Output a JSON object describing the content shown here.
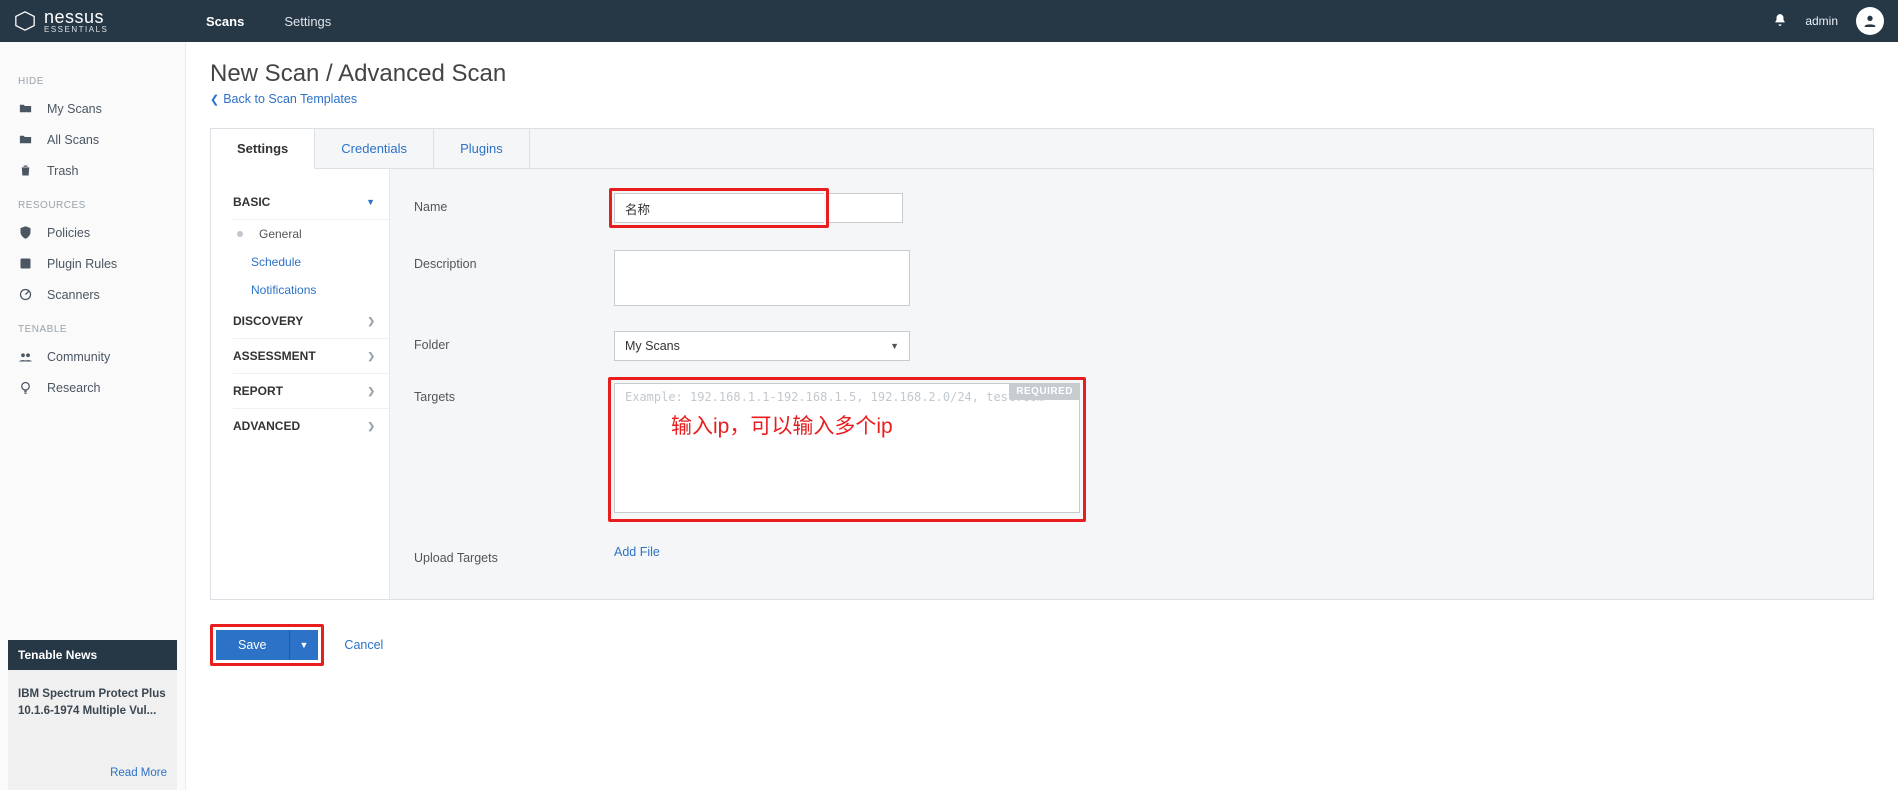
{
  "brand": {
    "name": "nessus",
    "edition": "ESSENTIALS"
  },
  "topnav": {
    "scans": "Scans",
    "settings": "Settings"
  },
  "user": {
    "name": "admin"
  },
  "sidebar": {
    "groups": {
      "hide": "HIDE",
      "resources": "RESOURCES",
      "tenable": "TENABLE"
    },
    "items": {
      "my_scans": "My Scans",
      "all_scans": "All Scans",
      "trash": "Trash",
      "policies": "Policies",
      "plugin_rules": "Plugin Rules",
      "scanners": "Scanners",
      "community": "Community",
      "research": "Research"
    }
  },
  "news": {
    "head": "Tenable News",
    "body": "IBM Spectrum Protect Plus 10.1.6-1974 Multiple Vul...",
    "readmore": "Read More"
  },
  "page": {
    "title": "New Scan / Advanced Scan",
    "back": "Back to Scan Templates"
  },
  "tabs": {
    "settings": "Settings",
    "credentials": "Credentials",
    "plugins": "Plugins"
  },
  "settings_nav": {
    "basic": "BASIC",
    "general": "General",
    "schedule": "Schedule",
    "notifications": "Notifications",
    "discovery": "DISCOVERY",
    "assessment": "ASSESSMENT",
    "report": "REPORT",
    "advanced": "ADVANCED"
  },
  "form": {
    "name_label": "Name",
    "name_value": "名称",
    "description_label": "Description",
    "description_value": "",
    "folder_label": "Folder",
    "folder_value": "My Scans",
    "targets_label": "Targets",
    "targets_placeholder": "Example: 192.168.1.1-192.168.1.5, 192.168.2.0/24, test.com",
    "required_badge": "REQUIRED",
    "targets_annotation": "输入ip，可以输入多个ip",
    "upload_label": "Upload Targets",
    "addfile": "Add File"
  },
  "footer": {
    "save": "Save",
    "cancel": "Cancel"
  }
}
